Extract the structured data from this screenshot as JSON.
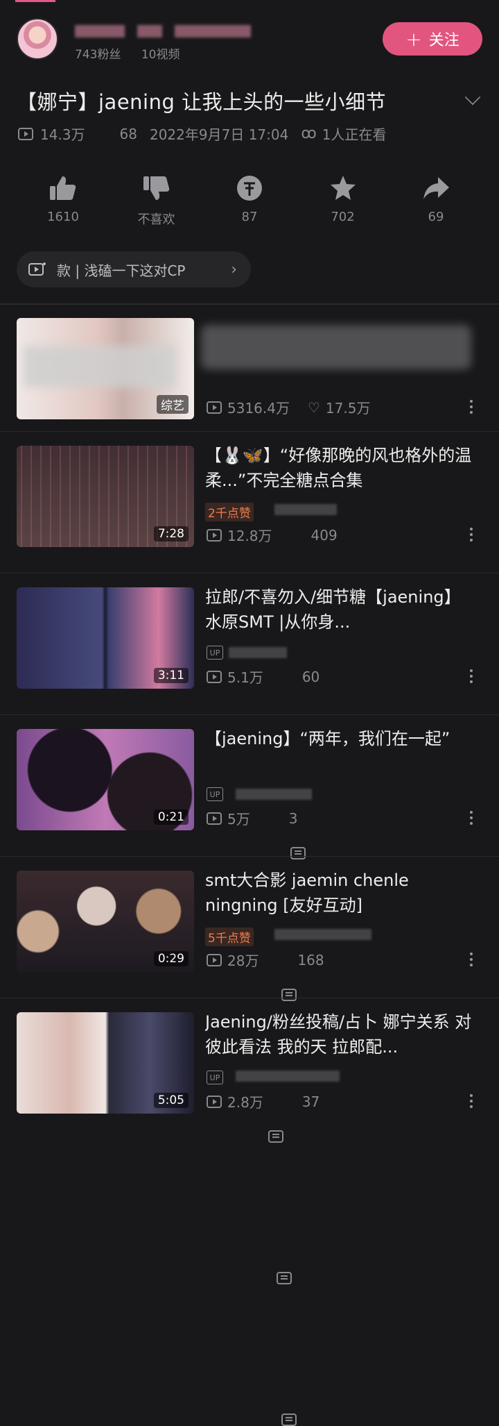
{
  "uploader": {
    "followers": "743粉丝",
    "videos": "10视频",
    "follow_label": "关注",
    "follow_plus": "+"
  },
  "video": {
    "title": "【娜宁】jaening 让我上头的一些小细节",
    "views": "14.3万",
    "comments": "68",
    "date": "2022年9月7日 17:04",
    "watching": "1人正在看"
  },
  "actions": [
    {
      "label": "1610",
      "icon": "thumb-up-icon"
    },
    {
      "label": "不喜欢",
      "icon": "thumb-down-icon"
    },
    {
      "label": "87",
      "icon": "coin-icon"
    },
    {
      "label": "702",
      "icon": "star-icon"
    },
    {
      "label": "69",
      "icon": "share-icon"
    }
  ],
  "collection": {
    "text": "款 | 浅磕一下这对CP",
    "chevron": "›"
  },
  "list": [
    {
      "title": "",
      "duration": "综艺",
      "views": "5316.4万",
      "second": "17.5万",
      "like_badge": ""
    },
    {
      "title": "【🐰🦋】“好像那晚的风也格外的温柔...”不完全糖点合集",
      "duration": "7:28",
      "views": "12.8万",
      "second": "409",
      "like_badge": "2千点赞"
    },
    {
      "title": "拉郎/不喜勿入/细节糖【jaening】水原SMT |从你身...",
      "duration": "3:11",
      "views": "5.1万",
      "second": "60",
      "like_badge": ""
    },
    {
      "title": "【jaening】“两年，我们在一起”",
      "duration": "0:21",
      "views": "5万",
      "second": "3",
      "like_badge": ""
    },
    {
      "title": "smt大合影 jaemin chenle ningning [友好互动]",
      "duration": "0:29",
      "views": "28万",
      "second": "168",
      "like_badge": "5千点赞"
    },
    {
      "title": "Jaening/粉丝投稿/占卜 娜宁关系 对彼此看法 我的天 拉郎配...",
      "duration": "5:05",
      "views": "2.8万",
      "second": "37",
      "like_badge": ""
    }
  ],
  "up_tag": "UP",
  "colors": {
    "accent": "#e2557f",
    "background": "#18181a",
    "muted": "#8a8a8e"
  }
}
